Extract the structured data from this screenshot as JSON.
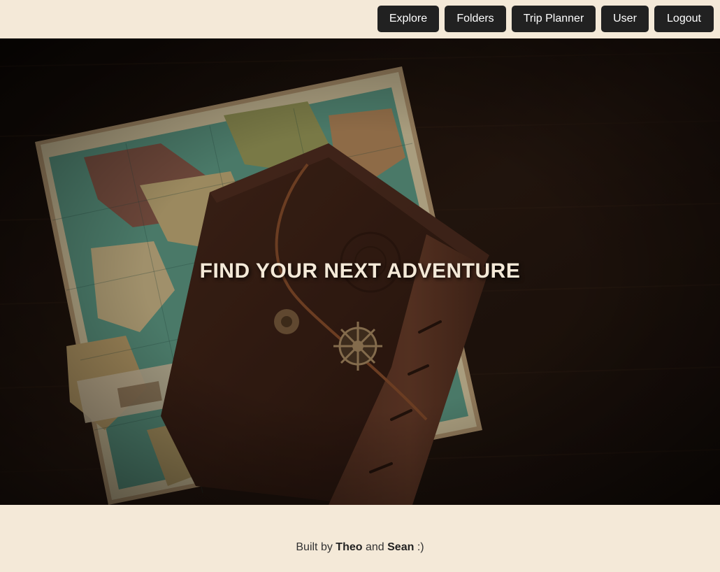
{
  "nav": {
    "explore_label": "Explore",
    "folders_label": "Folders",
    "trip_planner_label": "Trip Planner",
    "user_label": "User",
    "logout_label": "Logout"
  },
  "hero": {
    "title": "FIND YOUR NEXT ADVENTURE",
    "image": "hero-image-map-and-leather-journal"
  },
  "footer": {
    "prefix": "Built by",
    "author1": "Theo",
    "conjunction": "and",
    "author2": "Sean",
    "suffix": ":)"
  },
  "colors": {
    "background": "#f4e9d8",
    "button": "#212121",
    "button_text": "#ffffff",
    "hero_text": "#f4e9d8"
  }
}
